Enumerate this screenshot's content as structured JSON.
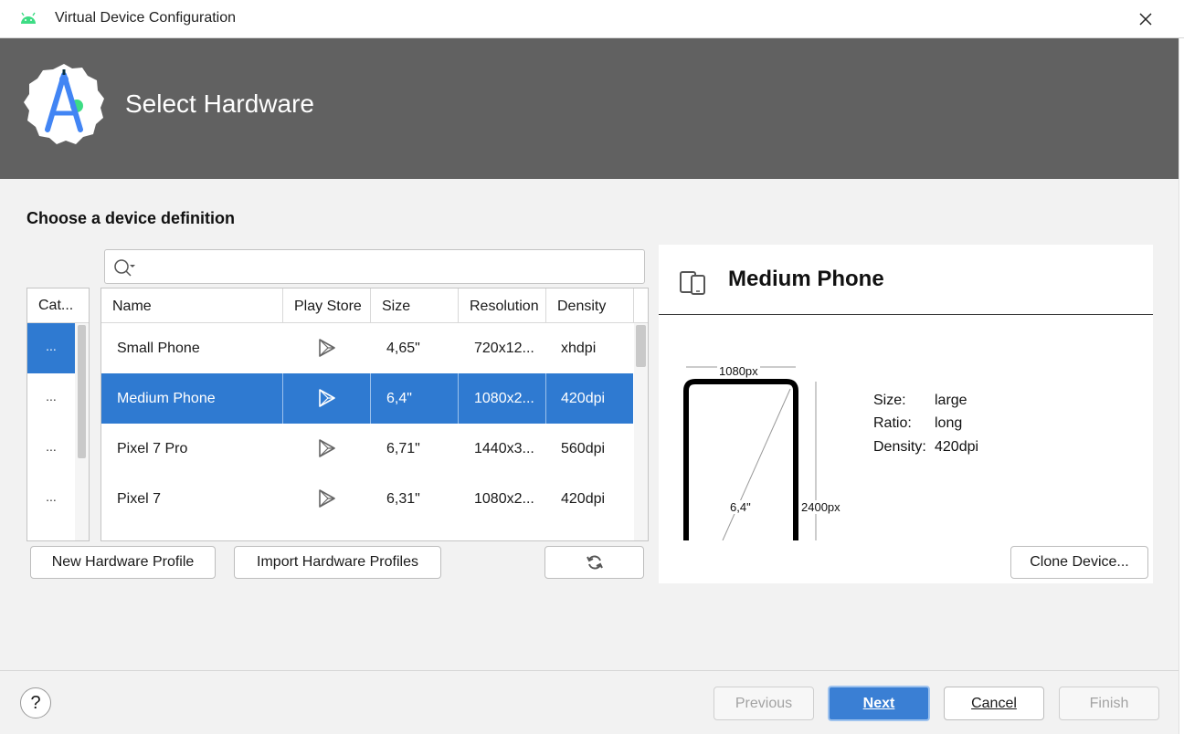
{
  "window": {
    "title": "Virtual Device Configuration"
  },
  "header": {
    "title": "Select Hardware"
  },
  "page": {
    "subtitle": "Choose a device definition"
  },
  "search": {
    "value": "",
    "placeholder": ""
  },
  "categories": {
    "header": "Cat...",
    "items": [
      {
        "label": "...",
        "selected": true
      },
      {
        "label": "...",
        "selected": false
      },
      {
        "label": "...",
        "selected": false
      },
      {
        "label": "...",
        "selected": false
      }
    ]
  },
  "table": {
    "columns": [
      "Name",
      "Play Store",
      "Size",
      "Resolution",
      "Density"
    ],
    "rows": [
      {
        "name": "Small Phone",
        "play_store": true,
        "size": "4,65\"",
        "resolution": "720x12...",
        "density": "xhdpi",
        "selected": false
      },
      {
        "name": "Medium Phone",
        "play_store": true,
        "size": "6,4\"",
        "resolution": "1080x2...",
        "density": "420dpi",
        "selected": true
      },
      {
        "name": "Pixel 7 Pro",
        "play_store": true,
        "size": "6,71\"",
        "resolution": "1440x3...",
        "density": "560dpi",
        "selected": false
      },
      {
        "name": "Pixel 7",
        "play_store": true,
        "size": "6,31\"",
        "resolution": "1080x2...",
        "density": "420dpi",
        "selected": false
      }
    ]
  },
  "buttons": {
    "new_profile": "New Hardware Profile",
    "import_profiles": "Import Hardware Profiles",
    "clone_device": "Clone Device...",
    "previous": "Previous",
    "next": "Next",
    "cancel": "Cancel",
    "finish": "Finish",
    "help": "?"
  },
  "detail": {
    "name": "Medium Phone",
    "width_label": "1080px",
    "height_label": "2400px",
    "diagonal_label": "6,4\"",
    "specs": [
      {
        "label": "Size:",
        "value": "large"
      },
      {
        "label": "Ratio:",
        "value": "long"
      },
      {
        "label": "Density:",
        "value": "420dpi"
      }
    ]
  },
  "colors": {
    "selection": "#2f7ad1",
    "header_bg": "#616161",
    "primary_button": "#3a7fd4"
  },
  "icons": [
    "android-icon",
    "close-icon",
    "android-studio-logo",
    "search-icon",
    "play-store-icon",
    "refresh-icon",
    "devices-icon",
    "help-icon"
  ]
}
